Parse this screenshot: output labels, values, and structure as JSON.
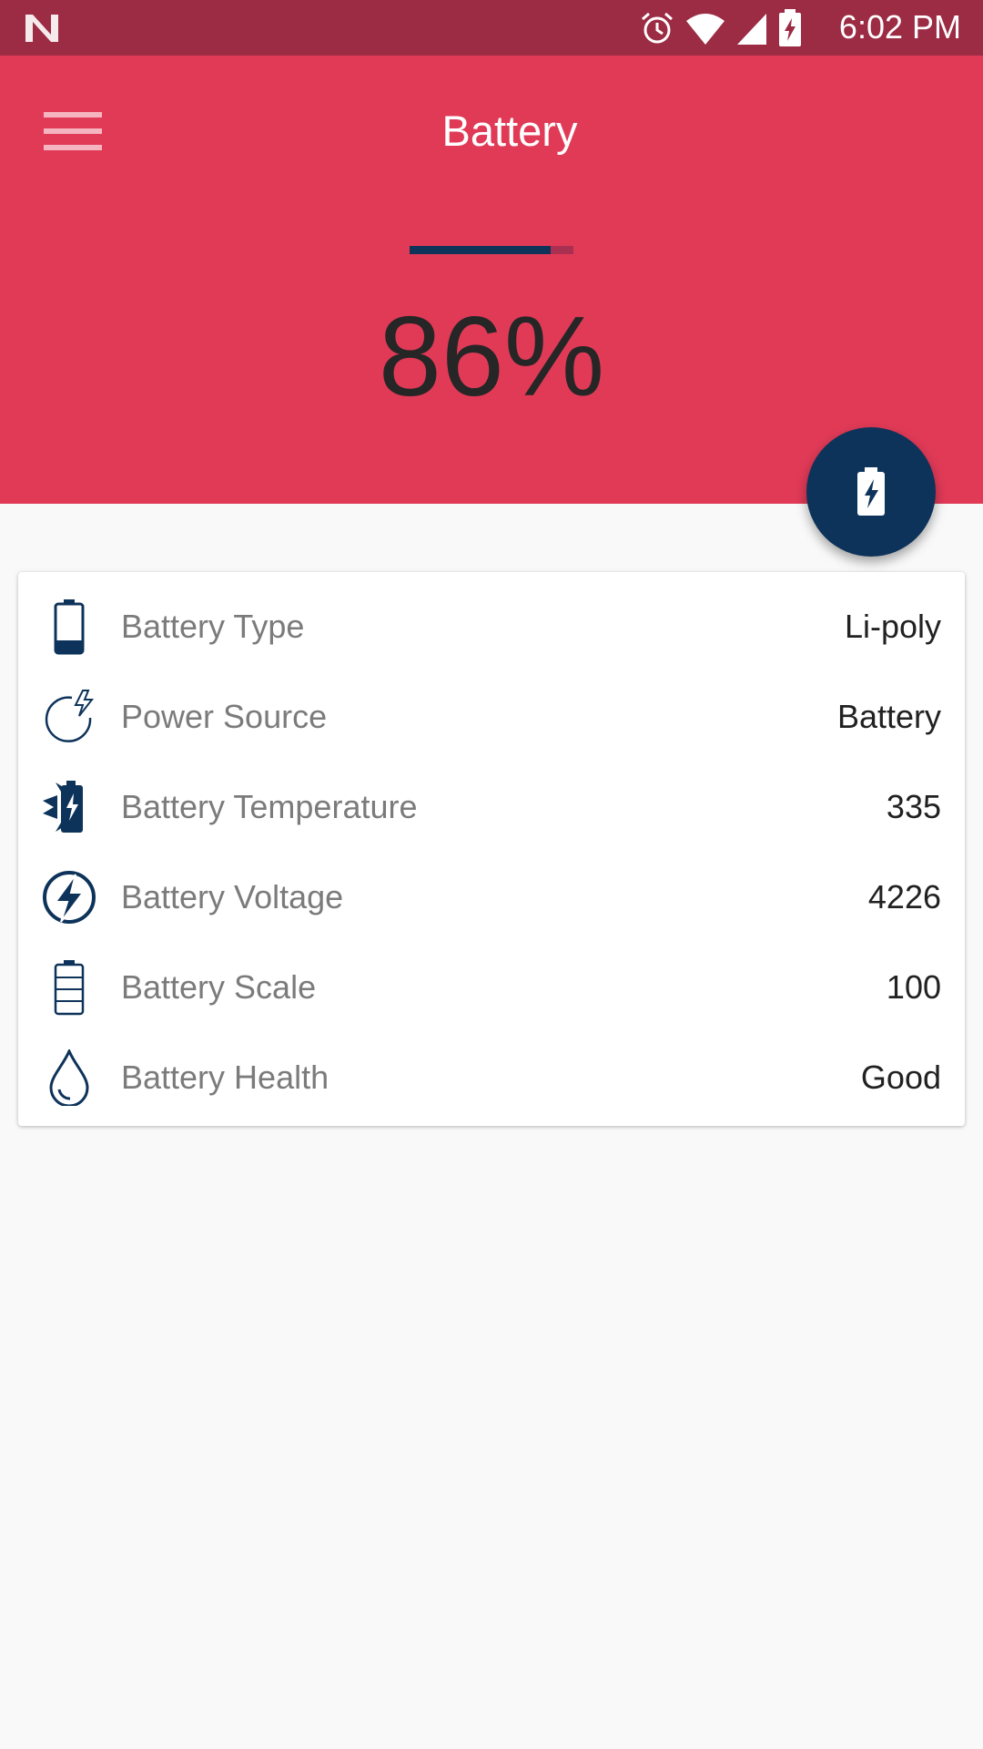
{
  "status_bar": {
    "time": "6:02 PM",
    "icons": [
      "n-logo-icon",
      "alarm-icon",
      "wifi-icon",
      "signal-icon",
      "battery-charging-icon"
    ]
  },
  "toolbar": {
    "title": "Battery",
    "menu_icon": "hamburger-menu-icon"
  },
  "battery_level": {
    "percent_text": "86%",
    "progress_fraction": 0.86
  },
  "fab": {
    "icon": "battery-charging-icon"
  },
  "details": [
    {
      "icon": "battery-icon",
      "label": "Battery Type",
      "value": "Li-poly"
    },
    {
      "icon": "power-source-icon",
      "label": "Power Source",
      "value": "Battery"
    },
    {
      "icon": "temperature-icon",
      "label": "Battery Temperature",
      "value": "335"
    },
    {
      "icon": "voltage-icon",
      "label": "Battery Voltage",
      "value": "4226"
    },
    {
      "icon": "battery-scale-icon",
      "label": "Battery Scale",
      "value": "100"
    },
    {
      "icon": "water-drop-icon",
      "label": "Battery Health",
      "value": "Good"
    }
  ],
  "colors": {
    "status_bar": "#9c2b44",
    "header": "#e03a57",
    "accent_navy": "#0e335a",
    "background": "#f9f9f9"
  }
}
